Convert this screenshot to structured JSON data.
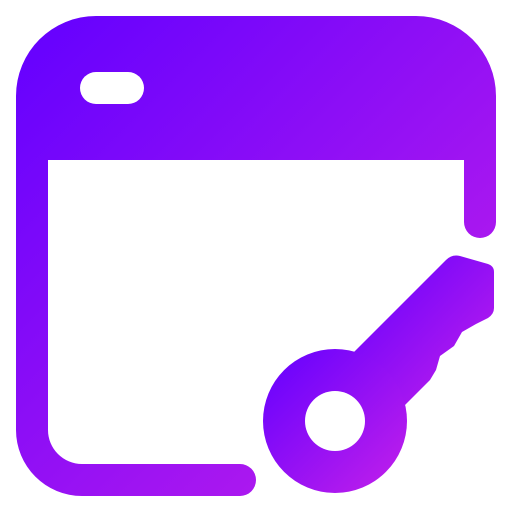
{
  "icon": {
    "name": "browser-key-icon",
    "gradient_start": "#6200ff",
    "gradient_end": "#c420ea"
  }
}
